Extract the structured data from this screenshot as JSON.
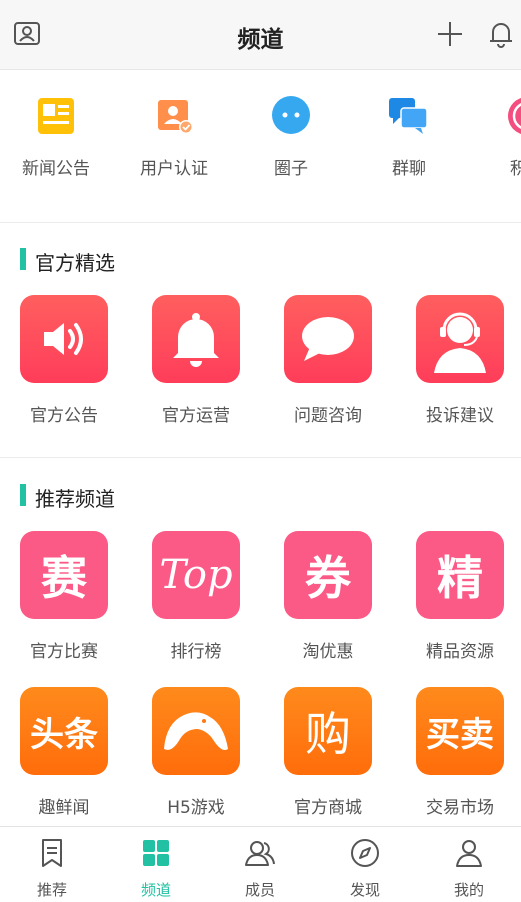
{
  "header": {
    "title": "频道"
  },
  "quick_items": [
    {
      "label": "新闻公告",
      "icon": "news-icon"
    },
    {
      "label": "用户认证",
      "icon": "user-verify-icon"
    },
    {
      "label": "圈子",
      "icon": "chat-bubble-icon"
    },
    {
      "label": "群聊",
      "icon": "group-chat-icon"
    },
    {
      "label": "积分",
      "icon": "points-icon"
    }
  ],
  "sections": [
    {
      "title": "官方精选",
      "items": [
        {
          "label": "官方公告",
          "icon": "speaker-icon"
        },
        {
          "label": "官方运营",
          "icon": "bell-icon"
        },
        {
          "label": "问题咨询",
          "icon": "speech-bubble-icon"
        },
        {
          "label": "投诉建议",
          "icon": "customer-service-icon"
        }
      ]
    },
    {
      "title": "推荐频道",
      "items": [
        {
          "label": "官方比赛",
          "glyph": "赛"
        },
        {
          "label": "排行榜",
          "glyph": "Top"
        },
        {
          "label": "淘优惠",
          "glyph": "券"
        },
        {
          "label": "精品资源",
          "glyph": "精"
        },
        {
          "label": "趣鲜闻",
          "glyph": "头条"
        },
        {
          "label": "H5游戏",
          "icon": "game-icon"
        },
        {
          "label": "官方商城",
          "glyph": "购"
        },
        {
          "label": "交易市场",
          "glyph": "买卖"
        }
      ]
    }
  ],
  "tabs": [
    {
      "label": "推荐",
      "icon": "bookmark-icon"
    },
    {
      "label": "频道",
      "icon": "grid-icon",
      "active": true
    },
    {
      "label": "成员",
      "icon": "members-icon"
    },
    {
      "label": "发现",
      "icon": "compass-icon"
    },
    {
      "label": "我的",
      "icon": "profile-icon"
    }
  ],
  "colors": {
    "accent": "#22c1a3",
    "red": "#ff4a5a",
    "pink": "#fb5986",
    "orange": "#ff7a12"
  }
}
